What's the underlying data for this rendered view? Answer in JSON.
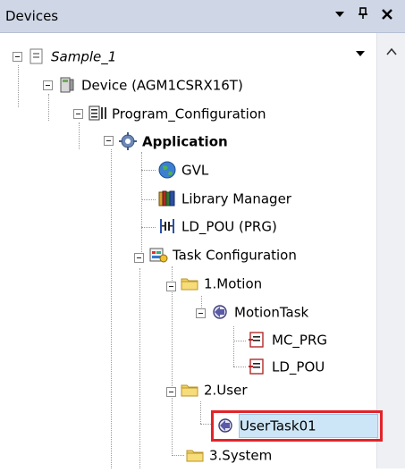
{
  "panel": {
    "title": "Devices",
    "controls": {
      "dropdown": "▾",
      "pin": "Ⴤ",
      "close": "✕"
    }
  },
  "tree": {
    "project": "Sample_1",
    "device": "Device (AGM1CSRX16T)",
    "program_configuration": "Program_Configuration",
    "application": "Application",
    "gvl": "GVL",
    "library_manager": "Library Manager",
    "ld_pou_prg": "LD_POU (PRG)",
    "task_configuration": "Task Configuration",
    "motion_folder": "1.Motion",
    "motion_task": "MotionTask",
    "mc_prg": "MC_PRG",
    "ld_pou": "LD_POU",
    "user_folder": "2.User",
    "user_task": "UserTask01",
    "system_folder": "3.System"
  },
  "colors": {
    "titlebar": "#cfd6e5",
    "selection_fill": "#cde6f7",
    "highlight_border": "#e2242a"
  }
}
